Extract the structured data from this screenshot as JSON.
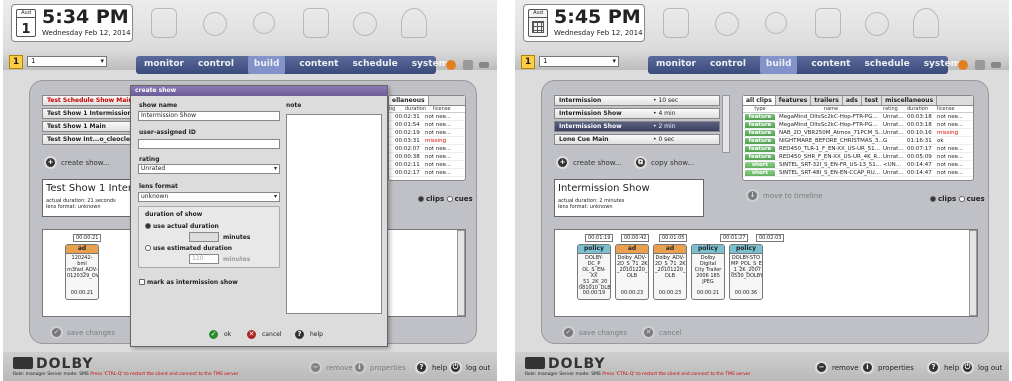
{
  "windows": [
    {
      "clock": {
        "month": "Aud",
        "day": "1",
        "time": "5:34 PM",
        "date": "Wednesday Feb 12, 2014"
      },
      "toolbar": {
        "warn": "1",
        "selector": "1"
      },
      "nav": [
        "monitor",
        "control",
        "build",
        "content",
        "schedule",
        "system"
      ],
      "shows": [
        {
          "name": "Test Schedule Show Main",
          "dur": ""
        },
        {
          "name": "Test Show 1 Intermission",
          "dur": ""
        },
        {
          "name": "Test Show 1 Main",
          "dur": ""
        },
        {
          "name": "Test Show Int...o_cleocleo",
          "dur": ""
        }
      ],
      "create_label": "create show...",
      "info": {
        "title": "Test Show 1 Intermis",
        "line1": "actual duration: 21 seconds",
        "line2": "lens format: unknown"
      },
      "list_tab": "ellaneous",
      "list_headers": [
        "ng",
        "duration",
        "license"
      ],
      "list_rows": [
        {
          "dur": "00:02:31",
          "lic": "not nee..."
        },
        {
          "dur": "00:01:54",
          "lic": "not nee..."
        },
        {
          "dur": "00:02:19",
          "lic": "not nee..."
        },
        {
          "dur": "00:03:31",
          "lic": "missing"
        },
        {
          "dur": "00:02:07",
          "lic": "not nee..."
        },
        {
          "dur": "00:00:38",
          "lic": "not nee..."
        },
        {
          "dur": "00:02:11",
          "lic": "not nee..."
        },
        {
          "dur": "00:02:17",
          "lic": "not nee..."
        }
      ],
      "radios": {
        "clips": "clips",
        "cues": "cues"
      },
      "timeline_tick": "00:00:21",
      "card": {
        "kind": "ad",
        "body": "120242-bml\nm3fad_ADV-...SE_51_2K_2\n0120329_OV",
        "foot": "00:00:21"
      },
      "bottom": {
        "save": "save changes",
        "cancel": "cancel",
        "remove": "remove",
        "properties": "properties",
        "help": "help",
        "logout": "log out",
        "logo": "DOLBY",
        "role": "Role: manager   Server mode: SMS",
        "hint": "Press 'CTRL-Q' to restart the client and connect to the TMS server"
      },
      "modal": {
        "title": "create show",
        "show_name_label": "show name",
        "show_name_value": "Intermission Show",
        "note_label": "note",
        "uid_label": "user-assigned ID",
        "rating_label": "rating",
        "rating_value": "Unrated",
        "lens_label": "lens format",
        "lens_value": "unknown",
        "dur_label": "duration of show",
        "actual": "use actual duration",
        "minutes": "minutes",
        "estimated": "use estimated duration",
        "est_value": "120",
        "mark": "mark as intermission show",
        "ok": "ok",
        "cancel": "cancel",
        "help": "help"
      }
    },
    {
      "clock": {
        "month": "Aud",
        "time": "5:45 PM",
        "date": "Wednesday Feb 12, 2014"
      },
      "toolbar": {
        "warn": "1",
        "selector": "1"
      },
      "nav": [
        "monitor",
        "control",
        "build",
        "content",
        "schedule",
        "system"
      ],
      "shows": [
        {
          "name": "Intermission",
          "dur": "10 sec"
        },
        {
          "name": "Intermission Show",
          "dur": "4 min"
        },
        {
          "name": "Intermission Show",
          "dur": "2 min"
        },
        {
          "name": "Lone Cue Main",
          "dur": "0 sec"
        }
      ],
      "create_label": "create show...",
      "copy_label": "copy show...",
      "info": {
        "title": "Intermission Show",
        "line1": "actual duration: 2 minutes",
        "line2": "lens format: unknown"
      },
      "tabs": [
        "all clips",
        "features",
        "trailers",
        "ads",
        "test",
        "miscellaneous"
      ],
      "list_headers": [
        "type",
        "name",
        "rating",
        "duration",
        "license"
      ],
      "list_rows": [
        {
          "type": "feature",
          "name": "MegaMind_DltsSc2kC-Hop-FTR-PG...",
          "rating": "Unrat...",
          "dur": "00:03:18",
          "lic": "not nee..."
        },
        {
          "type": "feature",
          "name": "MegaMind_DltsSc2kC-Hop-FTR-PG...",
          "rating": "Unrat...",
          "dur": "00:03:18",
          "lic": "not nee..."
        },
        {
          "type": "feature",
          "name": "NAB_2D_VBR250M_Atmos_71PCM_S...",
          "rating": "Unrat...",
          "dur": "00:10:16",
          "lic": "missing"
        },
        {
          "type": "feature",
          "name": "NIGHTMARE_BEFORE_CHRISTMAS_3...",
          "rating": "G",
          "dur": "01:16:31",
          "lic": "ok"
        },
        {
          "type": "feature",
          "name": "RED450_TLR-1_F_EN-XX_US-UR_51...",
          "rating": "Unrat...",
          "dur": "00:07:17",
          "lic": "not nee..."
        },
        {
          "type": "feature",
          "name": "RED450_SHR_F_EN-XX_US-UR_4K_R...",
          "rating": "Unrat...",
          "dur": "00:05:09",
          "lic": "not nee..."
        },
        {
          "type": "short",
          "name": "SINTEL_SRT-32I_S_EN-FR_US-13_51...",
          "rating": "<UN...",
          "dur": "00:14:47",
          "lic": "not nee..."
        },
        {
          "type": "short",
          "name": "SINTEL_SRT-48I_S_EN-EN-CCAP_RU...",
          "rating": "Unrat...",
          "dur": "00:14:47",
          "lic": "not nee..."
        }
      ],
      "move": "move to timeline",
      "radios": {
        "clips": "clips",
        "cues": "cues"
      },
      "ticks": [
        "00:01:19",
        "00:00:42",
        "00:01:05",
        "00:01:27",
        "00:02:03"
      ],
      "cards": [
        {
          "kind": "policy",
          "body": "DOLBY-DC_P\nOL_S_EN-XX\n_51_2K_20\n081010_DLB",
          "foot": "00:00:19"
        },
        {
          "kind": "ad",
          "body": "Dolby_ADV-\n2D_S_71_2K\n_20101220_\nDLB",
          "foot": "00:00:23"
        },
        {
          "kind": "ad",
          "body": "Dolby_ADV-\n2D_S_71_2K\n_20101220_\nDLB",
          "foot": "00:00:23"
        },
        {
          "kind": "policy",
          "body": "Dolby Digital\nCity Trailer\n2006 185\nJPEG",
          "foot": "00:00:21"
        },
        {
          "kind": "policy",
          "body": "DOLBY-STO\nMP_POL_S_E\n_1_2K_2007\n0530_DOLBY",
          "foot": "00:00:36"
        }
      ],
      "bottom": {
        "save": "save changes",
        "cancel": "cancel",
        "remove": "remove",
        "properties": "properties",
        "help": "help",
        "logout": "log out",
        "logo": "DOLBY",
        "role": "Role: manager   Server mode: SMS",
        "hint": "Press 'CTRL-Q' to restart the client and connect to the TMS server"
      }
    }
  ]
}
